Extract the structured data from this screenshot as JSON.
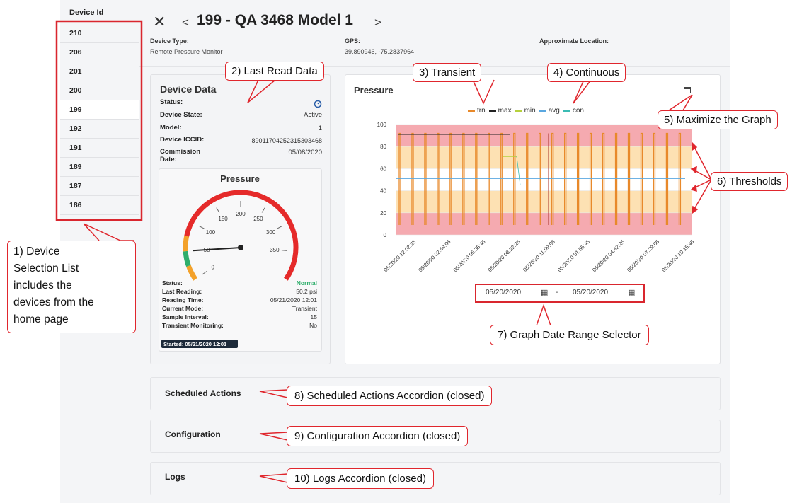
{
  "device_list": {
    "header": "Device Id",
    "items": [
      "210",
      "206",
      "201",
      "200",
      "199",
      "192",
      "191",
      "189",
      "187",
      "186"
    ],
    "selected": "199"
  },
  "header": {
    "title": "199 - QA 3468 Model 1",
    "device_type_label": "Device Type:",
    "device_type_value": "Remote Pressure Monitor",
    "gps_label": "GPS:",
    "gps_value": "39.890946, -75.2837964",
    "location_label": "Approximate Location:"
  },
  "device_data": {
    "title": "Device Data",
    "status_label": "Status:",
    "state_label": "Device State:",
    "state_value": "Active",
    "model_label": "Model:",
    "model_value": "1",
    "iccid_label": "Device ICCID:",
    "iccid_value": "89011704252315303468",
    "commission_label_1": "Commission",
    "commission_label_2": "Date:",
    "commission_value": "05/08/2020"
  },
  "gauge": {
    "title": "Pressure",
    "ticks": [
      "0",
      "50",
      "100",
      "150",
      "200",
      "250",
      "300",
      "350"
    ],
    "value": 50.2,
    "min": 0,
    "max": 400,
    "fields": [
      {
        "label": "Status:",
        "value": "Normal"
      },
      {
        "label": "Last Reading:",
        "value": "50.2 psi"
      },
      {
        "label": "Reading Time:",
        "value": "05/21/2020 12:01"
      },
      {
        "label": "Current Mode:",
        "value": "Transient"
      },
      {
        "label": "Sample Interval:",
        "value": "15"
      },
      {
        "label": "Transient Monitoring:",
        "value": "No"
      }
    ],
    "badge": "Started: 05/21/2020 12:01",
    "normal_color": "#2eae6b"
  },
  "chart_data": {
    "type": "line",
    "title": "Pressure",
    "legend": [
      "trn",
      "max",
      "min",
      "avg",
      "con"
    ],
    "legend_colors": [
      "#e8892a",
      "#222222",
      "#b6d13c",
      "#5aa7e0",
      "#3bbcb4"
    ],
    "ylim": [
      0,
      100
    ],
    "yticks": [
      "0",
      "20",
      "40",
      "60",
      "80",
      "100"
    ],
    "xticks": [
      "05/20/20 12:02:25",
      "05/20/20 02:49:05",
      "05/20/20 05:35:45",
      "05/20/20 08:22:25",
      "05/20/20 11:09:05",
      "05/20/20 01:55:45",
      "05/20/20 04:42:25",
      "05/20/20 07:29:05",
      "05/20/20 10:15:45"
    ],
    "threshold_bands": [
      {
        "from": 0,
        "to": 20,
        "color": "#f5aab0"
      },
      {
        "from": 20,
        "to": 40,
        "color": "#fde1b3"
      },
      {
        "from": 40,
        "to": 60,
        "color": "#ffffff"
      },
      {
        "from": 60,
        "to": 80,
        "color": "#fde1b3"
      },
      {
        "from": 80,
        "to": 100,
        "color": "#f5aab0"
      }
    ],
    "transient_spike_count": 23,
    "transient_high": 92,
    "transient_low": 9,
    "max_line": 91
  },
  "date_range": {
    "from": "05/20/2020",
    "separator": "-",
    "to": "05/20/2020"
  },
  "accordions": [
    "Scheduled Actions",
    "Configuration",
    "Logs"
  ],
  "callouts": {
    "c1": [
      "1) Device",
      "Selection List",
      "includes the",
      "devices from the",
      "home page"
    ],
    "c2": "2) Last Read Data",
    "c3": "3) Transient",
    "c4": "4) Continuous",
    "c5": "5) Maximize the Graph",
    "c6": "6) Thresholds",
    "c7": "7) Graph Date Range Selector",
    "c8": "8) Scheduled Actions Accordion (closed)",
    "c9": "9) Configuration Accordion (closed)",
    "c10": "10) Logs Accordion (closed)"
  },
  "colors": {
    "accent_red": "#e0262d",
    "gauge_red": "#e52a2a",
    "gauge_orange": "#f3a12a",
    "gauge_green": "#2eae6b"
  }
}
